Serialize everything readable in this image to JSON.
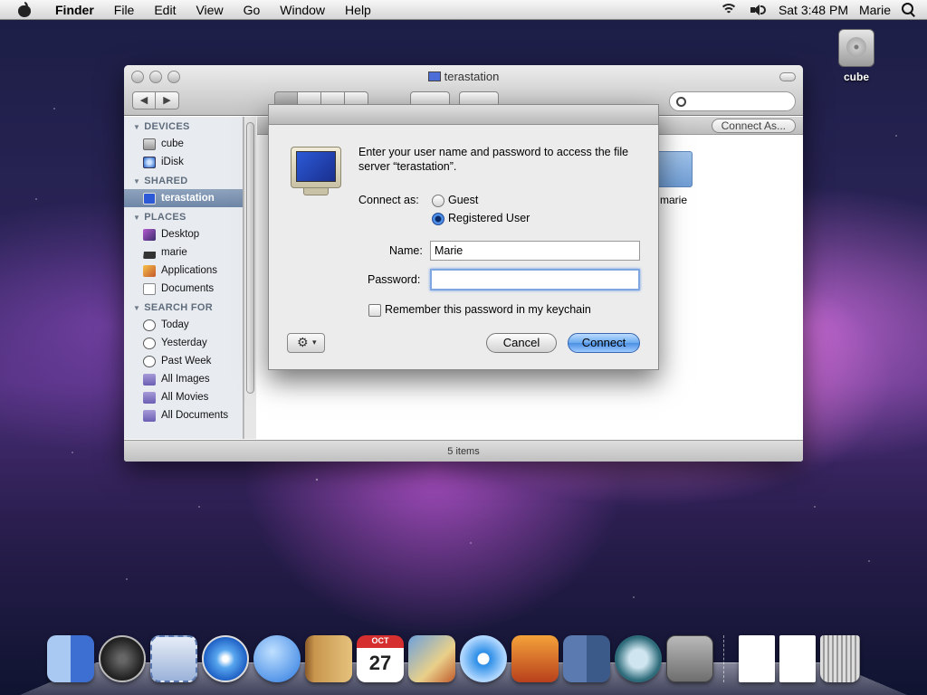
{
  "menubar": {
    "app_name": "Finder",
    "menus": [
      "File",
      "Edit",
      "View",
      "Go",
      "Window",
      "Help"
    ],
    "clock": "Sat 3:48 PM",
    "user": "Marie"
  },
  "desktop": {
    "drive_label": "cube"
  },
  "finder": {
    "title": "terastation",
    "connect_as_label": "Connect As...",
    "status": "5 items",
    "folder_label": "marie",
    "sidebar": {
      "devices_header": "DEVICES",
      "devices": [
        "cube",
        "iDisk"
      ],
      "shared_header": "SHARED",
      "shared": [
        "terastation"
      ],
      "places_header": "PLACES",
      "places": [
        "Desktop",
        "marie",
        "Applications",
        "Documents"
      ],
      "search_header": "SEARCH FOR",
      "search": [
        "Today",
        "Yesterday",
        "Past Week",
        "All Images",
        "All Movies",
        "All Documents"
      ]
    }
  },
  "dialog": {
    "message": "Enter your user name and password to access the file server “terastation”.",
    "connect_as_label": "Connect as:",
    "option_guest": "Guest",
    "option_registered": "Registered User",
    "selected_option": "Registered User",
    "name_label": "Name:",
    "name_value": "Marie",
    "password_label": "Password:",
    "password_value": "",
    "remember_label": "Remember this password in my keychain",
    "remember_checked": false,
    "cancel_label": "Cancel",
    "connect_label": "Connect"
  },
  "dock": {
    "items": [
      "finder-icon",
      "dashboard-icon",
      "mail-icon",
      "safari-icon",
      "ichat-icon",
      "address-book-icon",
      "ical-icon",
      "iphoto-icon",
      "itunes-icon",
      "photo-booth-icon",
      "spaces-icon",
      "time-machine-icon",
      "system-preferences-icon",
      "pdf-document-icon",
      "pdf-document-icon",
      "trash-icon"
    ],
    "ical_month": "OCT",
    "ical_day": "27"
  },
  "colors": {
    "accent_blue": "#4b8fe2",
    "sidebar_selected": "#6e86a6",
    "sidebar_bg": "#e8ecf1"
  }
}
